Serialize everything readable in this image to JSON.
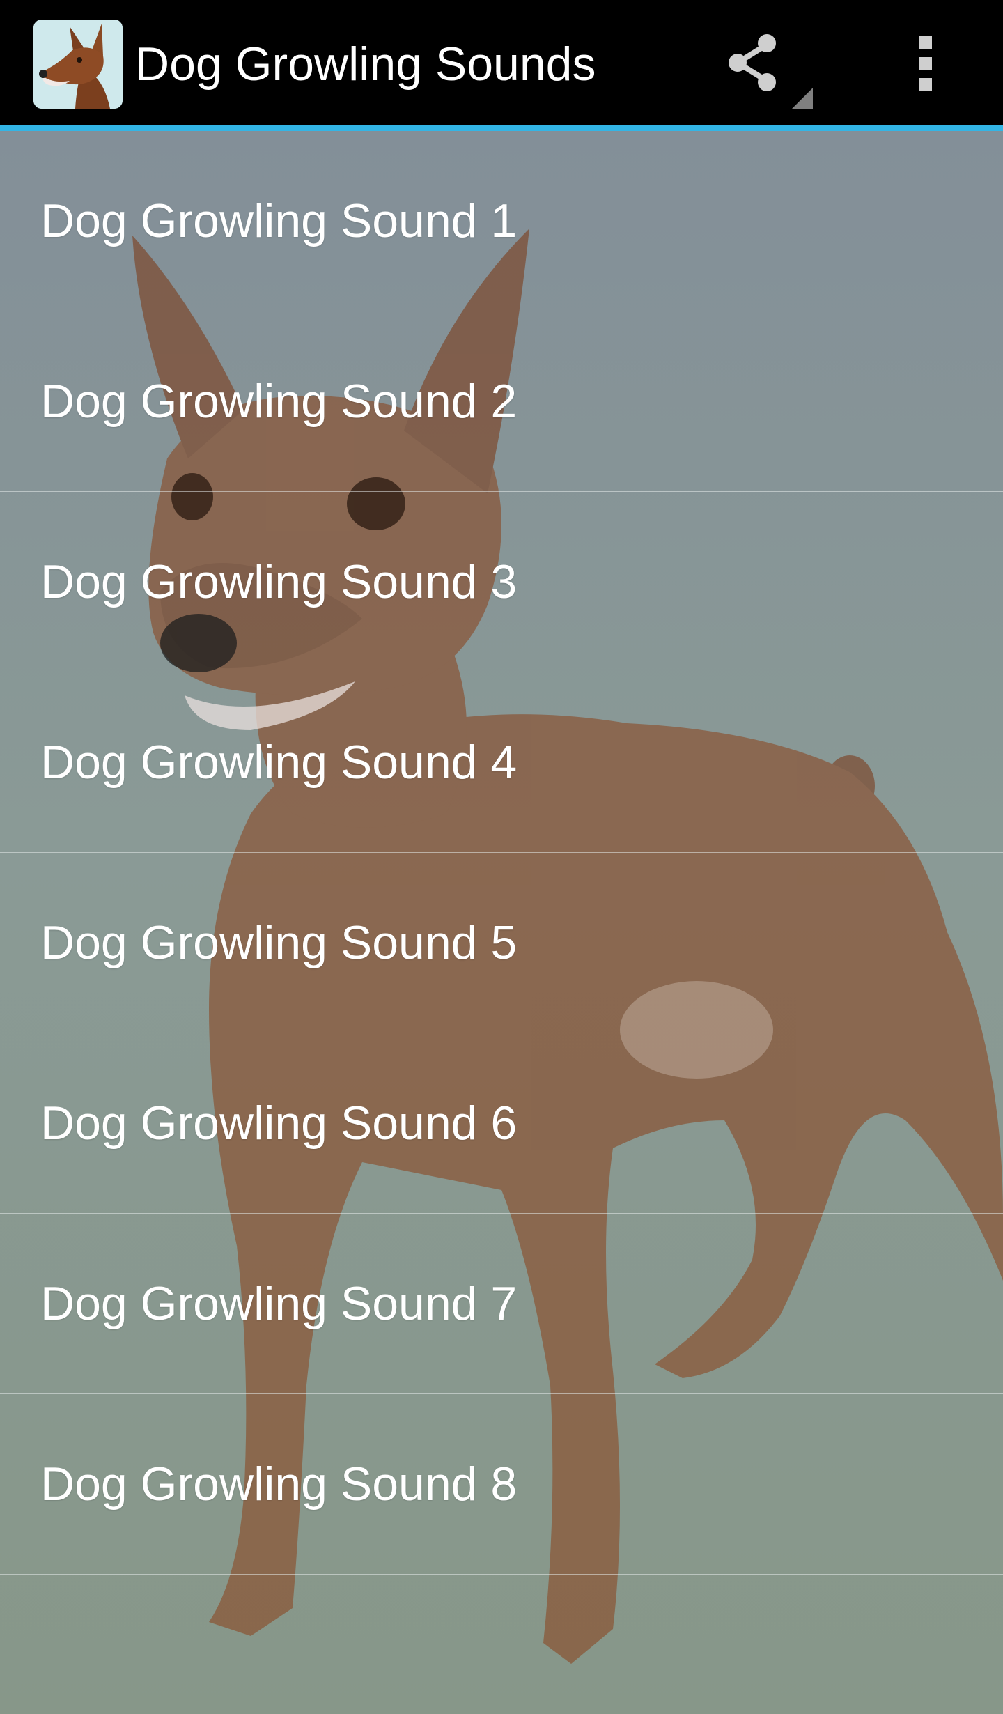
{
  "app": {
    "title": "Dog Growling Sounds",
    "accent_color": "#33b5e5",
    "bar_color": "#000000"
  },
  "actions": {
    "share_icon": "share-icon",
    "overflow_icon": "overflow-menu-icon"
  },
  "sounds": [
    {
      "label": "Dog Growling Sound 1"
    },
    {
      "label": "Dog Growling Sound 2"
    },
    {
      "label": "Dog Growling Sound 3"
    },
    {
      "label": "Dog Growling Sound 4"
    },
    {
      "label": "Dog Growling Sound 5"
    },
    {
      "label": "Dog Growling Sound 6"
    },
    {
      "label": "Dog Growling Sound 7"
    },
    {
      "label": "Dog Growling Sound 8"
    }
  ]
}
